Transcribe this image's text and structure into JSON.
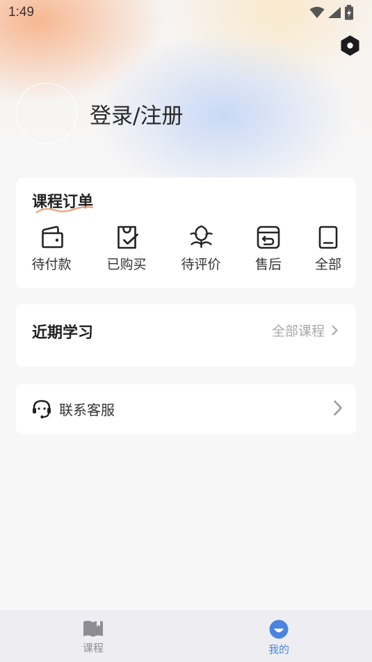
{
  "status_bar": {
    "time": "1:49"
  },
  "profile": {
    "login_label": "登录/注册"
  },
  "orders": {
    "title": "课程订单",
    "items": [
      {
        "label": "待付款",
        "icon": "wallet-icon"
      },
      {
        "label": "已购买",
        "icon": "purchased-bag-icon"
      },
      {
        "label": "待评价",
        "icon": "flower-review-icon"
      },
      {
        "label": "售后",
        "icon": "after-sales-box-icon"
      },
      {
        "label": "全部",
        "icon": "all-orders-icon"
      }
    ]
  },
  "recent": {
    "title": "近期学习",
    "all_link": "全部课程"
  },
  "contact": {
    "label": "联系客服",
    "icon": "headset-icon"
  },
  "tabs": [
    {
      "label": "课程",
      "icon": "book-icon",
      "active": false
    },
    {
      "label": "我的",
      "icon": "smile-face-icon",
      "active": true
    }
  ],
  "colors": {
    "accent": "#4a84e0",
    "inactive_tab": "#8d8d93",
    "swoosh": "#e8a77c",
    "muted_text": "#a8a8a8"
  }
}
